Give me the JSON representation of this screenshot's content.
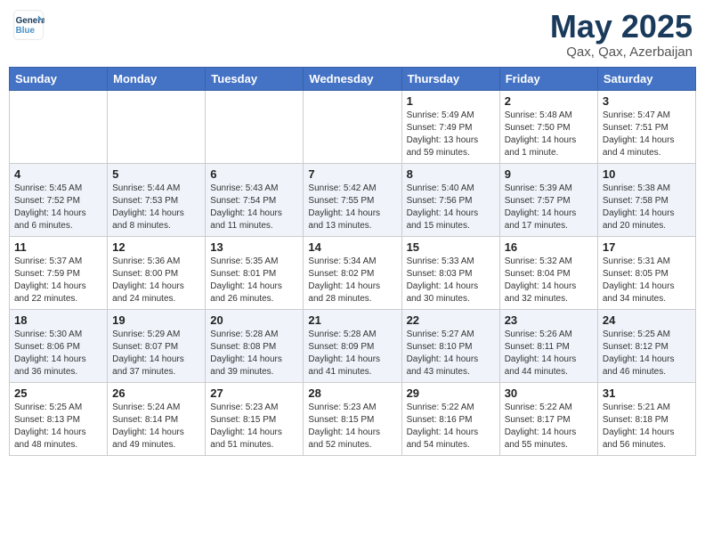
{
  "header": {
    "logo_line1": "General",
    "logo_line2": "Blue",
    "month": "May 2025",
    "location": "Qax, Qax, Azerbaijan"
  },
  "weekdays": [
    "Sunday",
    "Monday",
    "Tuesday",
    "Wednesday",
    "Thursday",
    "Friday",
    "Saturday"
  ],
  "weeks": [
    [
      {
        "day": "",
        "info": ""
      },
      {
        "day": "",
        "info": ""
      },
      {
        "day": "",
        "info": ""
      },
      {
        "day": "",
        "info": ""
      },
      {
        "day": "1",
        "info": "Sunrise: 5:49 AM\nSunset: 7:49 PM\nDaylight: 13 hours\nand 59 minutes."
      },
      {
        "day": "2",
        "info": "Sunrise: 5:48 AM\nSunset: 7:50 PM\nDaylight: 14 hours\nand 1 minute."
      },
      {
        "day": "3",
        "info": "Sunrise: 5:47 AM\nSunset: 7:51 PM\nDaylight: 14 hours\nand 4 minutes."
      }
    ],
    [
      {
        "day": "4",
        "info": "Sunrise: 5:45 AM\nSunset: 7:52 PM\nDaylight: 14 hours\nand 6 minutes."
      },
      {
        "day": "5",
        "info": "Sunrise: 5:44 AM\nSunset: 7:53 PM\nDaylight: 14 hours\nand 8 minutes."
      },
      {
        "day": "6",
        "info": "Sunrise: 5:43 AM\nSunset: 7:54 PM\nDaylight: 14 hours\nand 11 minutes."
      },
      {
        "day": "7",
        "info": "Sunrise: 5:42 AM\nSunset: 7:55 PM\nDaylight: 14 hours\nand 13 minutes."
      },
      {
        "day": "8",
        "info": "Sunrise: 5:40 AM\nSunset: 7:56 PM\nDaylight: 14 hours\nand 15 minutes."
      },
      {
        "day": "9",
        "info": "Sunrise: 5:39 AM\nSunset: 7:57 PM\nDaylight: 14 hours\nand 17 minutes."
      },
      {
        "day": "10",
        "info": "Sunrise: 5:38 AM\nSunset: 7:58 PM\nDaylight: 14 hours\nand 20 minutes."
      }
    ],
    [
      {
        "day": "11",
        "info": "Sunrise: 5:37 AM\nSunset: 7:59 PM\nDaylight: 14 hours\nand 22 minutes."
      },
      {
        "day": "12",
        "info": "Sunrise: 5:36 AM\nSunset: 8:00 PM\nDaylight: 14 hours\nand 24 minutes."
      },
      {
        "day": "13",
        "info": "Sunrise: 5:35 AM\nSunset: 8:01 PM\nDaylight: 14 hours\nand 26 minutes."
      },
      {
        "day": "14",
        "info": "Sunrise: 5:34 AM\nSunset: 8:02 PM\nDaylight: 14 hours\nand 28 minutes."
      },
      {
        "day": "15",
        "info": "Sunrise: 5:33 AM\nSunset: 8:03 PM\nDaylight: 14 hours\nand 30 minutes."
      },
      {
        "day": "16",
        "info": "Sunrise: 5:32 AM\nSunset: 8:04 PM\nDaylight: 14 hours\nand 32 minutes."
      },
      {
        "day": "17",
        "info": "Sunrise: 5:31 AM\nSunset: 8:05 PM\nDaylight: 14 hours\nand 34 minutes."
      }
    ],
    [
      {
        "day": "18",
        "info": "Sunrise: 5:30 AM\nSunset: 8:06 PM\nDaylight: 14 hours\nand 36 minutes."
      },
      {
        "day": "19",
        "info": "Sunrise: 5:29 AM\nSunset: 8:07 PM\nDaylight: 14 hours\nand 37 minutes."
      },
      {
        "day": "20",
        "info": "Sunrise: 5:28 AM\nSunset: 8:08 PM\nDaylight: 14 hours\nand 39 minutes."
      },
      {
        "day": "21",
        "info": "Sunrise: 5:28 AM\nSunset: 8:09 PM\nDaylight: 14 hours\nand 41 minutes."
      },
      {
        "day": "22",
        "info": "Sunrise: 5:27 AM\nSunset: 8:10 PM\nDaylight: 14 hours\nand 43 minutes."
      },
      {
        "day": "23",
        "info": "Sunrise: 5:26 AM\nSunset: 8:11 PM\nDaylight: 14 hours\nand 44 minutes."
      },
      {
        "day": "24",
        "info": "Sunrise: 5:25 AM\nSunset: 8:12 PM\nDaylight: 14 hours\nand 46 minutes."
      }
    ],
    [
      {
        "day": "25",
        "info": "Sunrise: 5:25 AM\nSunset: 8:13 PM\nDaylight: 14 hours\nand 48 minutes."
      },
      {
        "day": "26",
        "info": "Sunrise: 5:24 AM\nSunset: 8:14 PM\nDaylight: 14 hours\nand 49 minutes."
      },
      {
        "day": "27",
        "info": "Sunrise: 5:23 AM\nSunset: 8:15 PM\nDaylight: 14 hours\nand 51 minutes."
      },
      {
        "day": "28",
        "info": "Sunrise: 5:23 AM\nSunset: 8:15 PM\nDaylight: 14 hours\nand 52 minutes."
      },
      {
        "day": "29",
        "info": "Sunrise: 5:22 AM\nSunset: 8:16 PM\nDaylight: 14 hours\nand 54 minutes."
      },
      {
        "day": "30",
        "info": "Sunrise: 5:22 AM\nSunset: 8:17 PM\nDaylight: 14 hours\nand 55 minutes."
      },
      {
        "day": "31",
        "info": "Sunrise: 5:21 AM\nSunset: 8:18 PM\nDaylight: 14 hours\nand 56 minutes."
      }
    ]
  ]
}
